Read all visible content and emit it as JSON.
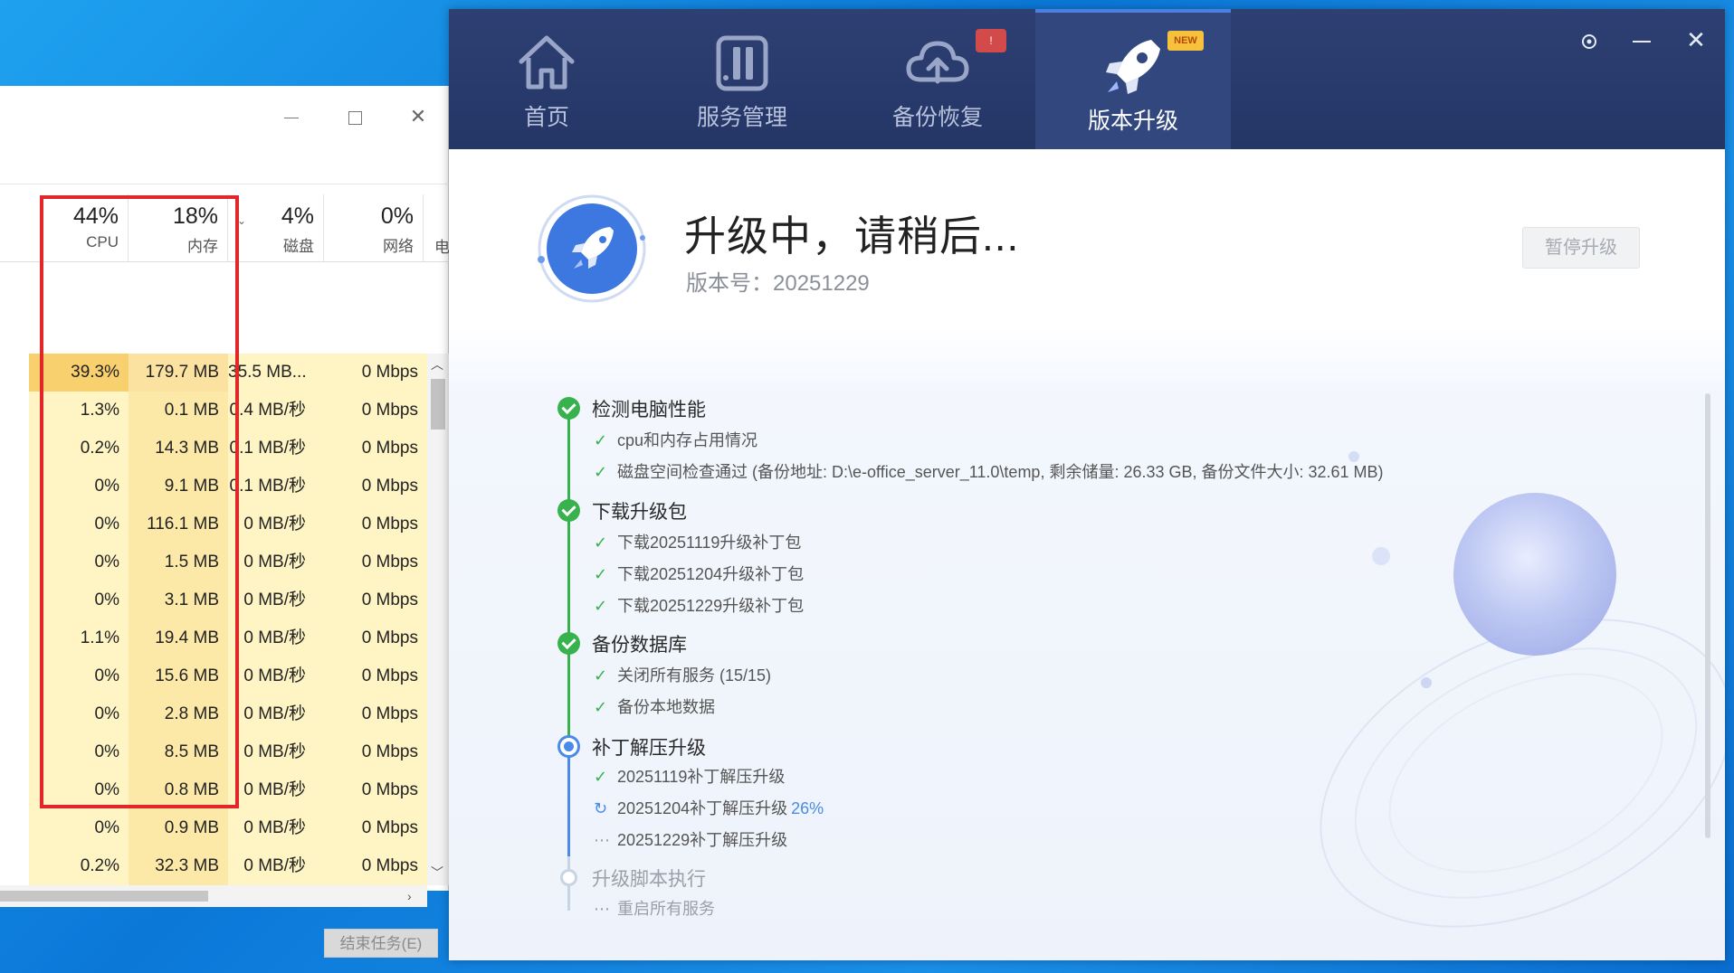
{
  "taskmgr": {
    "header": {
      "cpu": {
        "pct": "44%",
        "label": "CPU"
      },
      "mem": {
        "pct": "18%",
        "label": "内存"
      },
      "disk": {
        "pct": "4%",
        "label": "磁盘"
      },
      "net": {
        "pct": "0%",
        "label": "网络"
      },
      "elec": "电"
    },
    "rows": [
      {
        "cpu": "39.3%",
        "mem": "179.7 MB",
        "disk": "35.5 MB...",
        "net": "0 Mbps"
      },
      {
        "cpu": "1.3%",
        "mem": "0.1 MB",
        "disk": "0.4 MB/秒",
        "net": "0 Mbps"
      },
      {
        "cpu": "0.2%",
        "mem": "14.3 MB",
        "disk": "0.1 MB/秒",
        "net": "0 Mbps"
      },
      {
        "cpu": "0%",
        "mem": "9.1 MB",
        "disk": "0.1 MB/秒",
        "net": "0 Mbps"
      },
      {
        "cpu": "0%",
        "mem": "116.1 MB",
        "disk": "0 MB/秒",
        "net": "0 Mbps"
      },
      {
        "cpu": "0%",
        "mem": "1.5 MB",
        "disk": "0 MB/秒",
        "net": "0 Mbps"
      },
      {
        "cpu": "0%",
        "mem": "3.1 MB",
        "disk": "0 MB/秒",
        "net": "0 Mbps"
      },
      {
        "cpu": "1.1%",
        "mem": "19.4 MB",
        "disk": "0 MB/秒",
        "net": "0 Mbps"
      },
      {
        "cpu": "0%",
        "mem": "15.6 MB",
        "disk": "0 MB/秒",
        "net": "0 Mbps"
      },
      {
        "cpu": "0%",
        "mem": "2.8 MB",
        "disk": "0 MB/秒",
        "net": "0 Mbps"
      },
      {
        "cpu": "0%",
        "mem": "8.5 MB",
        "disk": "0 MB/秒",
        "net": "0 Mbps"
      },
      {
        "cpu": "0%",
        "mem": "0.8 MB",
        "disk": "0 MB/秒",
        "net": "0 Mbps"
      },
      {
        "cpu": "0%",
        "mem": "0.9 MB",
        "disk": "0 MB/秒",
        "net": "0 Mbps"
      },
      {
        "cpu": "0.2%",
        "mem": "32.3 MB",
        "disk": "0 MB/秒",
        "net": "0 Mbps"
      }
    ],
    "end_task_label": "结束任务(E)"
  },
  "app": {
    "nav": {
      "home": "首页",
      "service": "服务管理",
      "backup": "备份恢复",
      "upgrade": "版本升级",
      "backup_badge": "!",
      "new_badge": "NEW"
    },
    "title": "升级中，请稍后...",
    "version_label": "版本号：",
    "version": "20251229",
    "pause_label": "暂停升级",
    "steps": {
      "s1": {
        "title": "检测电脑性能",
        "items": [
          "cpu和内存占用情况",
          "磁盘空间检查通过 (备份地址: D:\\e-office_server_11.0\\temp, 剩余储量: 26.33 GB, 备份文件大小: 32.61 MB)"
        ]
      },
      "s2": {
        "title": "下载升级包",
        "items": [
          "下载20251119升级补丁包",
          "下载20251204升级补丁包",
          "下载20251229升级补丁包"
        ]
      },
      "s3": {
        "title": "备份数据库",
        "items": [
          "关闭所有服务 (15/15)",
          "备份本地数据"
        ]
      },
      "s4": {
        "title": "补丁解压升级",
        "items": [
          "20251119补丁解压升级",
          "20251204补丁解压升级",
          "20251229补丁解压升级"
        ],
        "progress": "26%"
      },
      "s5": {
        "title": "升级脚本执行",
        "items": [
          "重启所有服务"
        ]
      }
    },
    "icons": {
      "check": "✓",
      "spinner": "↻",
      "dots": "⋯"
    },
    "colors": {
      "nav_bg": "#2e3f73",
      "done_green": "#37b24d",
      "active_blue": "#4a8ae8",
      "highlight_red": "#e2262a"
    }
  }
}
